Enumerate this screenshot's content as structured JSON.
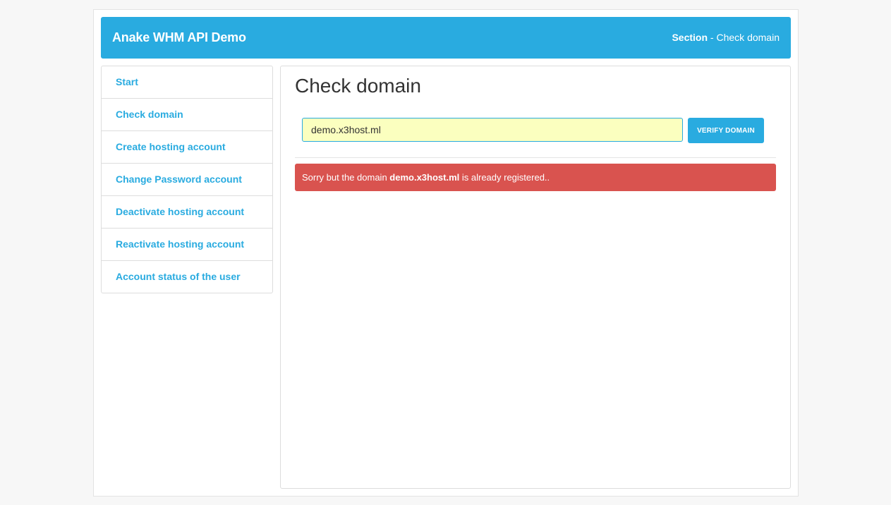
{
  "header": {
    "brand": "Anake WHM API Demo",
    "section_label": "Section",
    "section_sep": " - ",
    "section_value": "Check domain"
  },
  "sidebar": {
    "items": [
      {
        "label": "Start"
      },
      {
        "label": "Check domain"
      },
      {
        "label": "Create hosting account"
      },
      {
        "label": "Change Password account"
      },
      {
        "label": "Deactivate hosting account"
      },
      {
        "label": "Reactivate hosting account"
      },
      {
        "label": "Account status of the user"
      }
    ]
  },
  "main": {
    "title": "Check domain",
    "domain_input_value": "demo.x3host.ml",
    "verify_button_label": "VERIFY DOMAIN",
    "alert": {
      "prefix": "Sorry but the domain ",
      "domain": "demo.x3host.ml",
      "suffix": " is already registered.."
    }
  },
  "colors": {
    "accent": "#29abe0",
    "alert_danger": "#d9534f",
    "input_background": "#fbffbf"
  }
}
